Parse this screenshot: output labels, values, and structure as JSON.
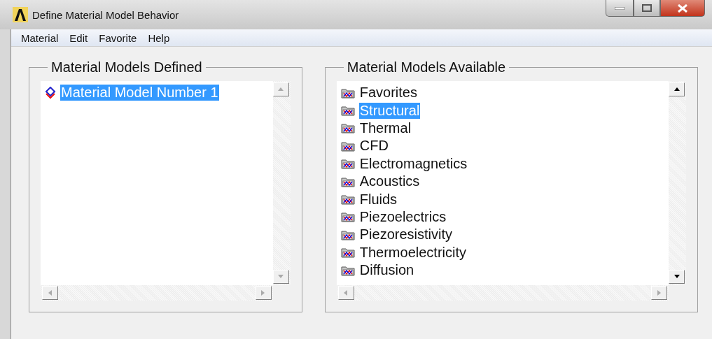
{
  "window": {
    "title": "Define Material Model Behavior"
  },
  "menu": [
    "Material",
    "Edit",
    "Favorite",
    "Help"
  ],
  "defined": {
    "title": "Material Models Defined",
    "items": [
      {
        "label": "Material Model Number 1",
        "selected": true
      }
    ]
  },
  "available": {
    "title": "Material Models Available",
    "items": [
      {
        "label": "Favorites",
        "selected": false
      },
      {
        "label": "Structural",
        "selected": true
      },
      {
        "label": "Thermal",
        "selected": false
      },
      {
        "label": "CFD",
        "selected": false
      },
      {
        "label": "Electromagnetics",
        "selected": false
      },
      {
        "label": "Acoustics",
        "selected": false
      },
      {
        "label": "Fluids",
        "selected": false
      },
      {
        "label": "Piezoelectrics",
        "selected": false
      },
      {
        "label": "Piezoresistivity",
        "selected": false
      },
      {
        "label": "Thermoelectricity",
        "selected": false
      },
      {
        "label": "Diffusion",
        "selected": false
      }
    ]
  }
}
